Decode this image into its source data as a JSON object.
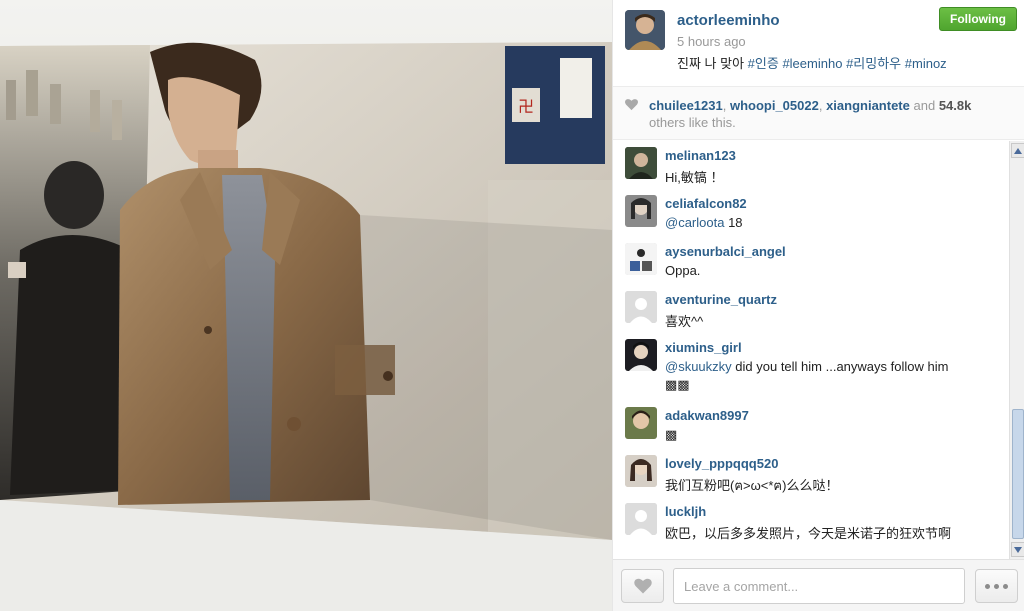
{
  "post": {
    "username": "actorleeminho",
    "time_ago": "5 hours ago",
    "caption_text": "진짜 나 맞아",
    "hashtags": [
      "#인증",
      "#leeminho",
      "#리밍하우",
      "#minoz"
    ],
    "follow_label": "Following"
  },
  "likes": {
    "users": [
      "chuilee1231",
      "whoopi_05022",
      "xiangniantete"
    ],
    "and": "and",
    "count": "54.8k",
    "suffix": "others like this."
  },
  "comments": [
    {
      "user": "melinan123",
      "text": "Hi,敏镐 ！"
    },
    {
      "user": "celiafalcon82",
      "mention": "@carloota",
      "text": " 18"
    },
    {
      "user": "aysenurbalci_angel",
      "text": "Oppa."
    },
    {
      "user": "aventurine_quartz",
      "text": "喜欢^^"
    },
    {
      "user": "xiumins_girl",
      "mention": "@skuukzky",
      "text": " did you tell him ...anyways follow him",
      "extra": "▩▩"
    },
    {
      "user": "adakwan8997",
      "text": "▩"
    },
    {
      "user": "lovely_pppqqq520",
      "text": "我们互粉吧(ฅ>ω<*ฅ)么么哒！"
    },
    {
      "user": "luckljh",
      "text": "欧巴，以后多多发照片，今天是米诺子的狂欢节啊"
    }
  ],
  "footer": {
    "comment_placeholder": "Leave a comment..."
  },
  "icons": {
    "like": "heart-icon",
    "more": "more-options-icon",
    "scroll_up": "chevron-up-icon",
    "scroll_down": "chevron-down-icon"
  },
  "colors": {
    "link": "#2d5f8a",
    "follow_button": "#4fa52f",
    "muted_text": "#999999"
  }
}
